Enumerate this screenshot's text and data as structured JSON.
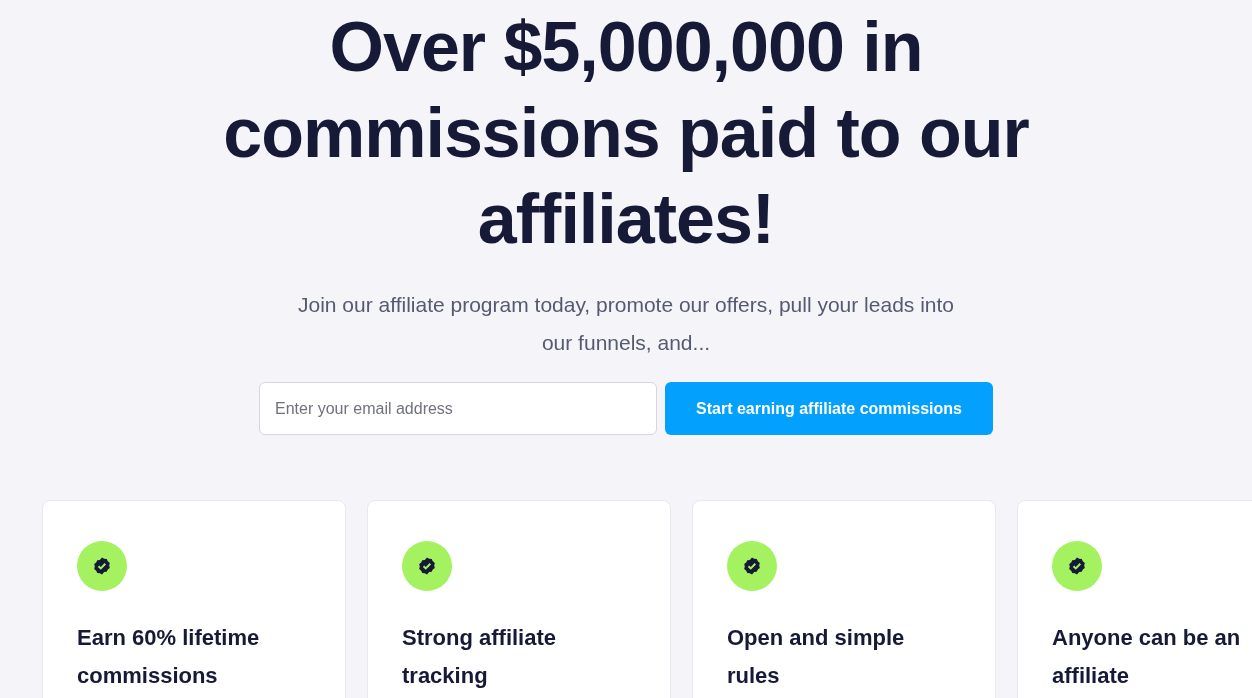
{
  "hero": {
    "headline": "Over $5,000,000 in commissions paid to our affiliates!",
    "subtitle": "Join our affiliate program today, promote our offers, pull your leads into our funnels, and...",
    "email_field": {
      "placeholder": "Enter your email address"
    },
    "cta_button": "Start earning affiliate commissions"
  },
  "features": [
    {
      "title": "Earn 60% lifetime commissions"
    },
    {
      "title": "Strong affiliate tracking"
    },
    {
      "title": "Open and simple rules"
    },
    {
      "title": "Anyone can be an affiliate"
    }
  ]
}
